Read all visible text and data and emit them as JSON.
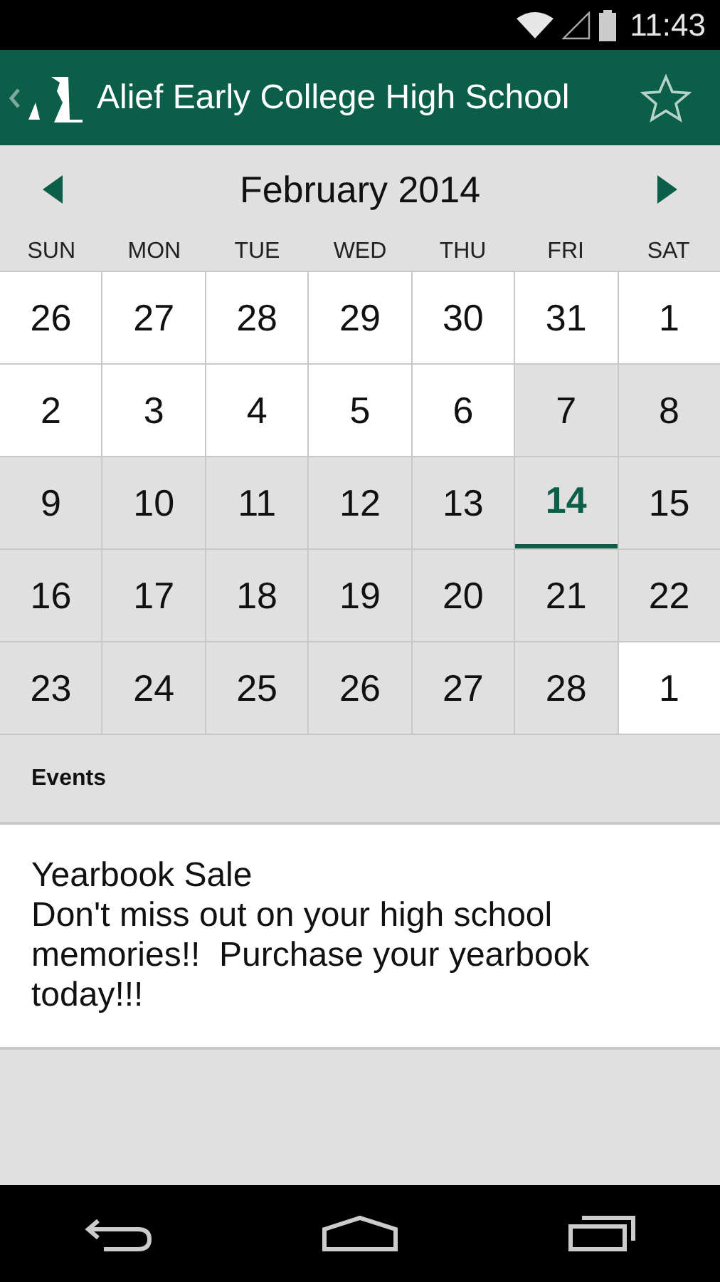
{
  "status_bar": {
    "time": "11:43"
  },
  "header": {
    "title": "Alief Early College High School",
    "favorite": false
  },
  "calendar": {
    "month": "February 2014",
    "weekdays": [
      "SUN",
      "MON",
      "TUE",
      "WED",
      "THU",
      "FRI",
      "SAT"
    ],
    "days": [
      {
        "label": "26",
        "shaded": false,
        "selected": false
      },
      {
        "label": "27",
        "shaded": false,
        "selected": false
      },
      {
        "label": "28",
        "shaded": false,
        "selected": false
      },
      {
        "label": "29",
        "shaded": false,
        "selected": false
      },
      {
        "label": "30",
        "shaded": false,
        "selected": false
      },
      {
        "label": "31",
        "shaded": false,
        "selected": false
      },
      {
        "label": "1",
        "shaded": false,
        "selected": false
      },
      {
        "label": "2",
        "shaded": false,
        "selected": false
      },
      {
        "label": "3",
        "shaded": false,
        "selected": false
      },
      {
        "label": "4",
        "shaded": false,
        "selected": false
      },
      {
        "label": "5",
        "shaded": false,
        "selected": false
      },
      {
        "label": "6",
        "shaded": false,
        "selected": false
      },
      {
        "label": "7",
        "shaded": true,
        "selected": false
      },
      {
        "label": "8",
        "shaded": true,
        "selected": false
      },
      {
        "label": "9",
        "shaded": true,
        "selected": false
      },
      {
        "label": "10",
        "shaded": true,
        "selected": false
      },
      {
        "label": "11",
        "shaded": true,
        "selected": false
      },
      {
        "label": "12",
        "shaded": true,
        "selected": false
      },
      {
        "label": "13",
        "shaded": true,
        "selected": false
      },
      {
        "label": "14",
        "shaded": true,
        "selected": true
      },
      {
        "label": "15",
        "shaded": true,
        "selected": false
      },
      {
        "label": "16",
        "shaded": true,
        "selected": false
      },
      {
        "label": "17",
        "shaded": true,
        "selected": false
      },
      {
        "label": "18",
        "shaded": true,
        "selected": false
      },
      {
        "label": "19",
        "shaded": true,
        "selected": false
      },
      {
        "label": "20",
        "shaded": true,
        "selected": false
      },
      {
        "label": "21",
        "shaded": true,
        "selected": false
      },
      {
        "label": "22",
        "shaded": true,
        "selected": false
      },
      {
        "label": "23",
        "shaded": true,
        "selected": false
      },
      {
        "label": "24",
        "shaded": true,
        "selected": false
      },
      {
        "label": "25",
        "shaded": true,
        "selected": false
      },
      {
        "label": "26",
        "shaded": true,
        "selected": false
      },
      {
        "label": "27",
        "shaded": true,
        "selected": false
      },
      {
        "label": "28",
        "shaded": true,
        "selected": false
      },
      {
        "label": "1",
        "shaded": false,
        "selected": false
      }
    ]
  },
  "events": {
    "heading": "Events",
    "items": [
      {
        "title": "Yearbook Sale",
        "description": "Don't miss out on your high school memories!!  Purchase your yearbook today!!!"
      }
    ]
  }
}
